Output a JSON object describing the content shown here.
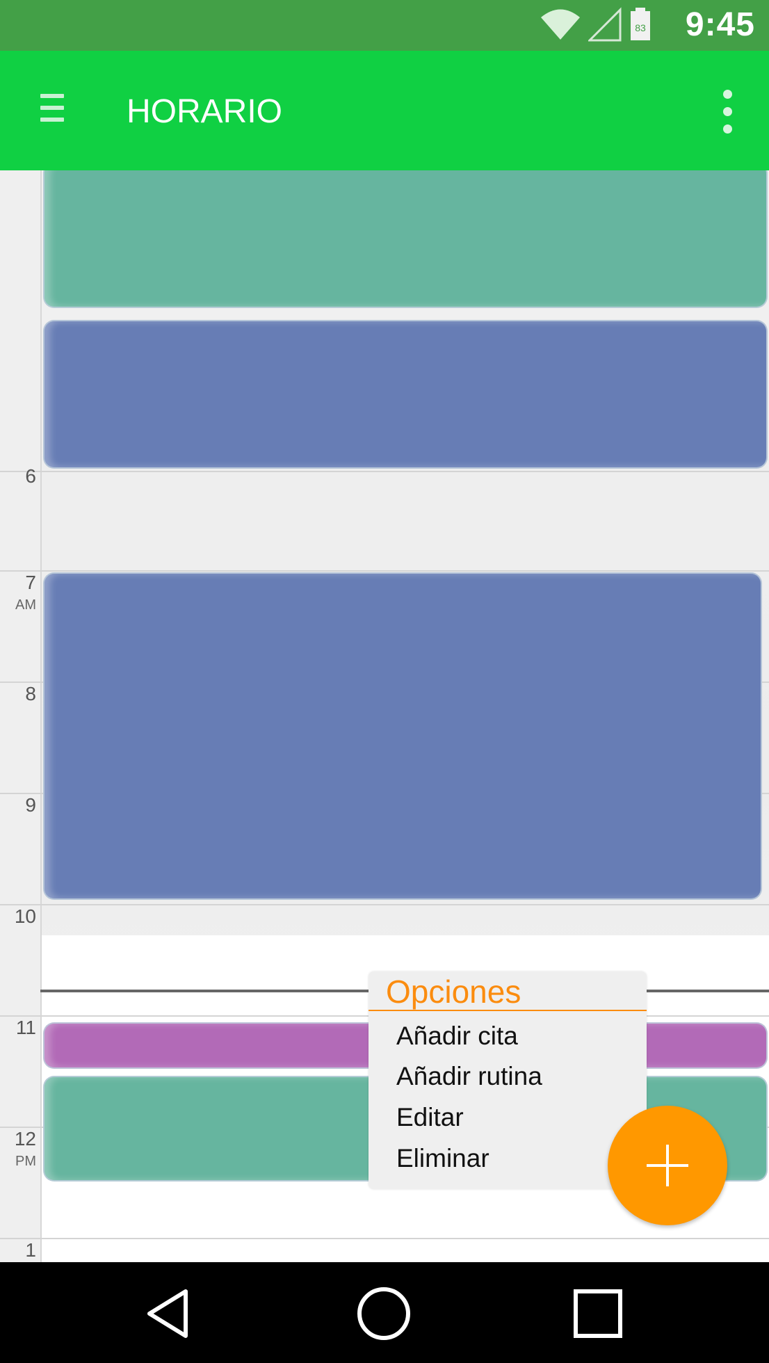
{
  "status_bar": {
    "time": "9:45",
    "battery_level": "83",
    "icons": [
      "wifi-icon",
      "cell-signal-icon",
      "battery-icon"
    ],
    "background": "#43a047"
  },
  "app_bar": {
    "title": "HORARIO",
    "icons": [
      "menu-icon",
      "overflow-menu-icon"
    ],
    "background": "#10d043"
  },
  "schedule": {
    "hours": [
      {
        "label": "6",
        "sub": ""
      },
      {
        "label": "7",
        "sub": "AM"
      },
      {
        "label": "8",
        "sub": ""
      },
      {
        "label": "9",
        "sub": ""
      },
      {
        "label": "10",
        "sub": ""
      },
      {
        "label": "11",
        "sub": ""
      },
      {
        "label": "12",
        "sub": "PM"
      },
      {
        "label": "1",
        "sub": ""
      }
    ],
    "event_colors": {
      "teal": "#66b59f",
      "blue": "#677db5",
      "purple": "#b26ab7"
    }
  },
  "popup": {
    "title": "Opciones",
    "items": [
      "Añadir cita",
      "Añadir rutina",
      "Editar",
      "Eliminar"
    ],
    "accent": "#fb8c0f"
  },
  "fab": {
    "icon": "plus-icon",
    "color": "#ff9800"
  },
  "nav_bar": {
    "icons": [
      "back-icon",
      "home-icon",
      "recents-icon"
    ]
  }
}
